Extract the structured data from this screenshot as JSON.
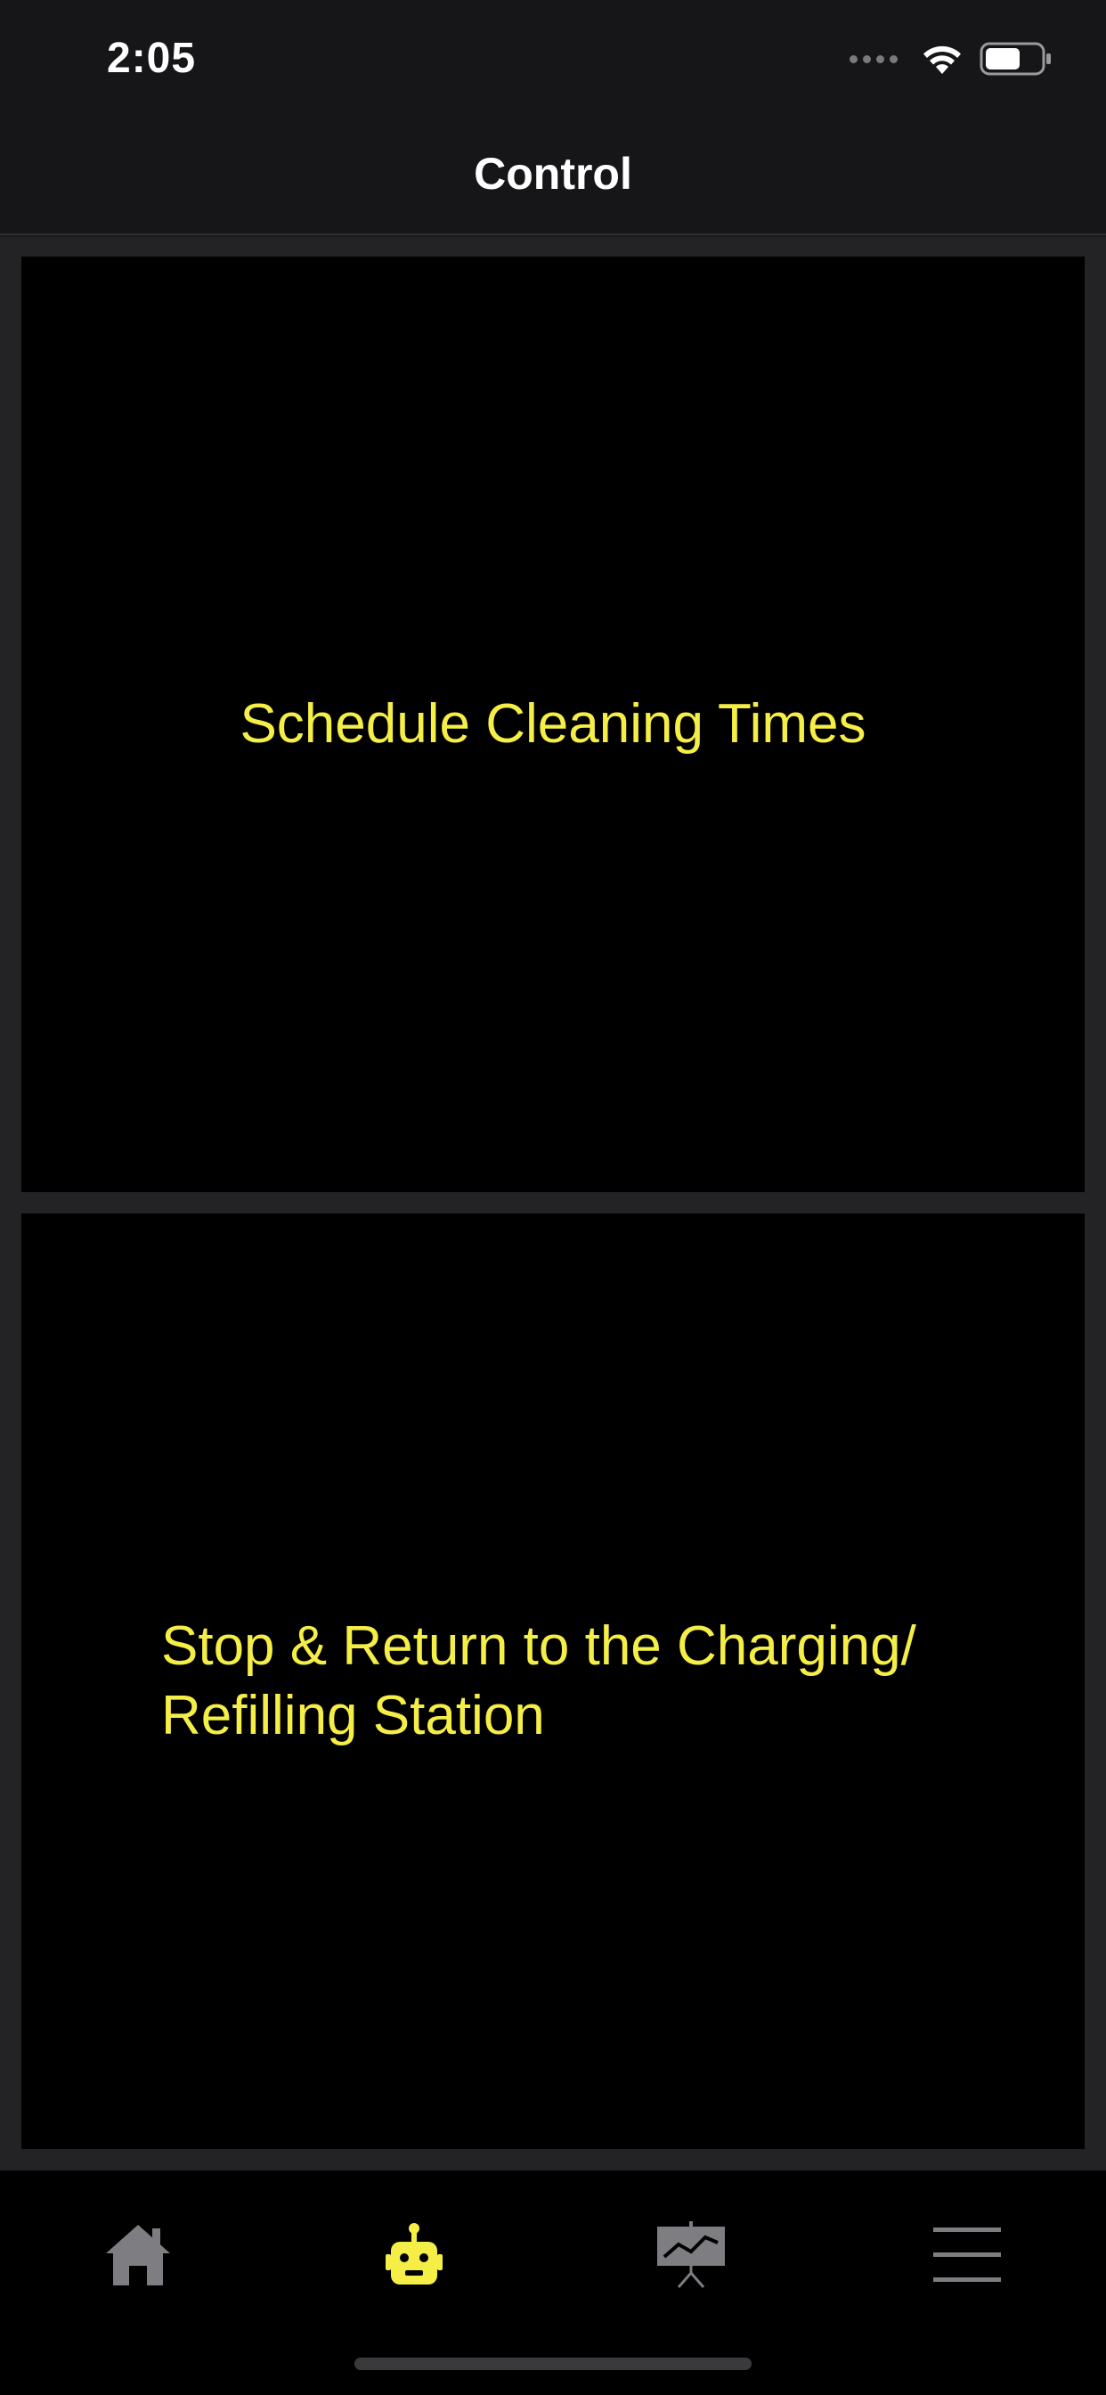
{
  "status_bar": {
    "time": "2:05",
    "icons": [
      "signal-icon",
      "wifi-icon",
      "battery-icon"
    ]
  },
  "nav": {
    "title": "Control"
  },
  "actions": [
    {
      "label": "Schedule Cleaning Times"
    },
    {
      "label": "Stop & Return to the Charging/ Refilling Station"
    }
  ],
  "tabs": [
    {
      "icon": "home-icon",
      "active": false
    },
    {
      "icon": "robot-icon",
      "active": true
    },
    {
      "icon": "chart-presentation-icon",
      "active": false
    },
    {
      "icon": "menu-icon",
      "active": false
    }
  ],
  "colors": {
    "accent": "#f5ee46",
    "inactive_icon": "#7d7d82",
    "background": "#000000",
    "bar": "#161618"
  }
}
